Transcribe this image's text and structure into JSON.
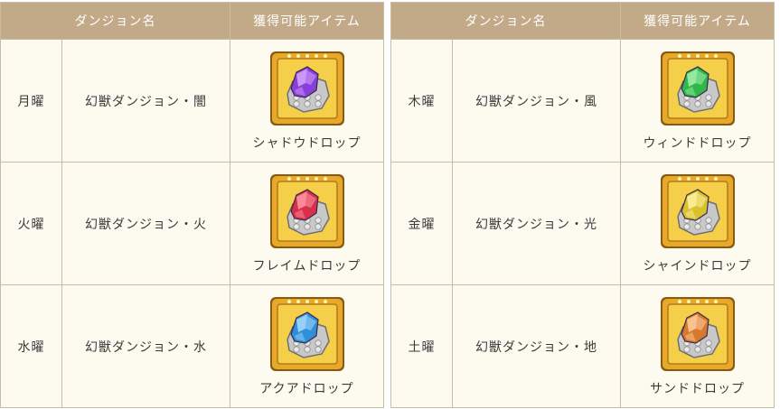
{
  "tables": [
    {
      "header": {
        "dungeon": "ダンジョン名",
        "item": "獲得可能アイテム"
      },
      "rows": [
        {
          "day": "月曜",
          "dungeon": "幻獣ダンジョン・闇",
          "item": "シャドウドロップ",
          "gem_color": "#8a3fd8",
          "gem_light": "#d6a8ff"
        },
        {
          "day": "火曜",
          "dungeon": "幻獣ダンジョン・火",
          "item": "フレイムドロップ",
          "gem_color": "#d8304a",
          "gem_light": "#ff9aa8"
        },
        {
          "day": "水曜",
          "dungeon": "幻獣ダンジョン・水",
          "item": "アクアドロップ",
          "gem_color": "#2f8fd8",
          "gem_light": "#a8dcff"
        }
      ]
    },
    {
      "header": {
        "dungeon": "ダンジョン名",
        "item": "獲得可能アイテム"
      },
      "rows": [
        {
          "day": "木曜",
          "dungeon": "幻獣ダンジョン・風",
          "item": "ウィンドドロップ",
          "gem_color": "#2fb84a",
          "gem_light": "#a8f0b0"
        },
        {
          "day": "金曜",
          "dungeon": "幻獣ダンジョン・光",
          "item": "シャインドロップ",
          "gem_color": "#d8c02f",
          "gem_light": "#fff3a0"
        },
        {
          "day": "土曜",
          "dungeon": "幻獣ダンジョン・地",
          "item": "サンドドロップ",
          "gem_color": "#d8782f",
          "gem_light": "#ffd0a0"
        }
      ]
    }
  ],
  "colors": {
    "header_bg": "#c2aa88",
    "cell_bg": "#fdfaf0",
    "border": "#c8bca6",
    "frame_gold": "#e8a82a"
  }
}
